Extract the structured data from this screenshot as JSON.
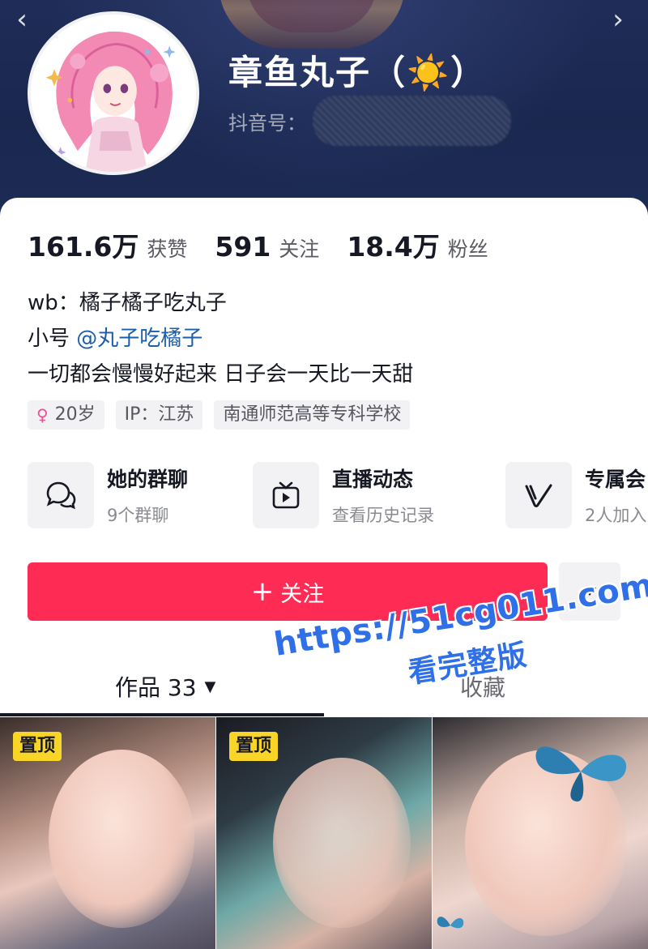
{
  "profile": {
    "nickname": "章鱼丸子（☀️）",
    "douyin_id_label": "抖音号："
  },
  "stats": [
    {
      "value": "161.6万",
      "label": "获赞"
    },
    {
      "value": "591",
      "label": "关注"
    },
    {
      "value": "18.4万",
      "label": "粉丝"
    }
  ],
  "bio": {
    "line1": "wb：橘子橘子吃丸子",
    "line2_prefix": "小号",
    "line2_mention": "@丸子吃橘子",
    "line3": "一切都会慢慢好起来 日子会一天比一天甜"
  },
  "tags": {
    "age": "20岁",
    "ip": "IP：江苏",
    "school": "南通师范高等专科学校"
  },
  "features": [
    {
      "title": "她的群聊",
      "subtitle": "9个群聊",
      "icon": "chat-bubbles-icon"
    },
    {
      "title": "直播动态",
      "subtitle": "查看历史记录",
      "icon": "tv-play-icon"
    },
    {
      "title": "专属会",
      "subtitle": "2人加入",
      "icon": "v-icon"
    }
  ],
  "actions": {
    "follow_plus": "+",
    "follow_label": "关注"
  },
  "tabs": {
    "works_label": "作品 33",
    "collect_label": "收藏"
  },
  "grid": {
    "pinned_label": "置顶",
    "pinned_label_2": "置顶"
  },
  "watermark": {
    "url": "https://51cg011.com",
    "text": "看完整版"
  },
  "colors": {
    "follow_button": "#fe2c55",
    "header_bg": "#1a2850",
    "mention": "#1d5ea8",
    "pin_badge": "#f9d528",
    "watermark": "#2f6fe8"
  }
}
